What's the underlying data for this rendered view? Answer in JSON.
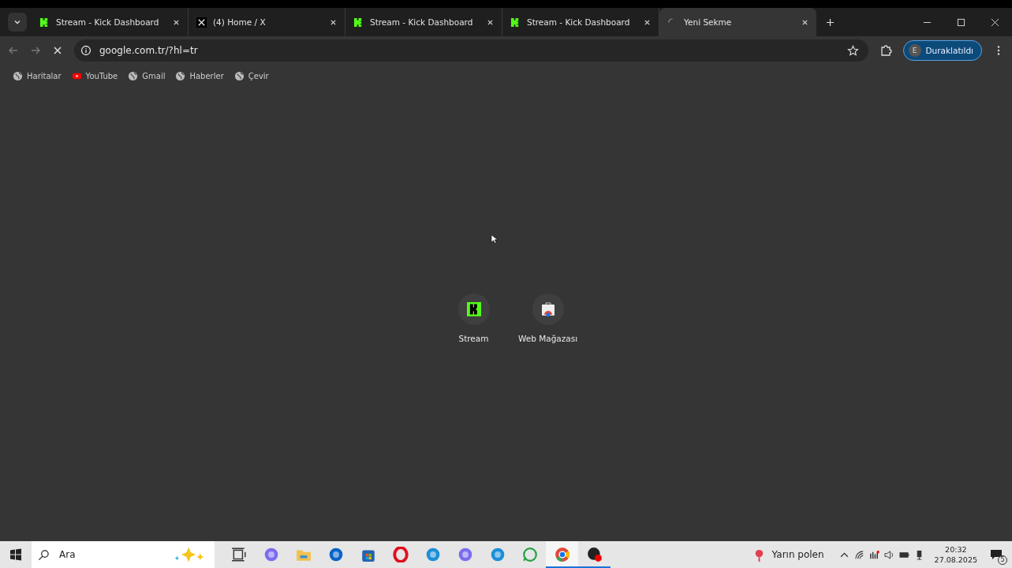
{
  "tabs": [
    {
      "kind": "kick",
      "title": "Stream - Kick Dashboard",
      "selected": false
    },
    {
      "kind": "x",
      "title": "(4) Home / X",
      "selected": false
    },
    {
      "kind": "kick",
      "title": "Stream - Kick Dashboard",
      "selected": false
    },
    {
      "kind": "kick",
      "title": "Stream - Kick Dashboard",
      "selected": false
    },
    {
      "kind": "loading",
      "title": "Yeni Sekme",
      "selected": true
    }
  ],
  "address_bar": {
    "url": "google.com.tr/?hl=tr",
    "loading": true
  },
  "profile": {
    "initial": "E",
    "label": "Duraklatıldı"
  },
  "bookmarks": [
    {
      "kind": "globe",
      "label": "Haritalar"
    },
    {
      "kind": "youtube",
      "label": "YouTube"
    },
    {
      "kind": "globe",
      "label": "Gmail"
    },
    {
      "kind": "globe",
      "label": "Haberler"
    },
    {
      "kind": "globe",
      "label": "Çevir"
    }
  ],
  "shortcuts": [
    {
      "kind": "kick",
      "label": "Stream"
    },
    {
      "kind": "webstore",
      "label": "Web Mağazası"
    }
  ],
  "taskbar": {
    "search_placeholder": "Ara",
    "apps": [
      {
        "kind": "taskview",
        "running": false,
        "selected": false
      },
      {
        "kind": "copilot",
        "running": false,
        "selected": false
      },
      {
        "kind": "folder",
        "running": false,
        "selected": false
      },
      {
        "kind": "outlook",
        "running": false,
        "selected": false
      },
      {
        "kind": "store",
        "running": false,
        "selected": false
      },
      {
        "kind": "opera",
        "running": false,
        "selected": false
      },
      {
        "kind": "edge",
        "running": false,
        "selected": false
      },
      {
        "kind": "copilot",
        "running": false,
        "selected": false
      },
      {
        "kind": "edge",
        "running": false,
        "selected": false
      },
      {
        "kind": "whatsapp",
        "running": false,
        "selected": false
      },
      {
        "kind": "chrome",
        "running": true,
        "selected": true
      },
      {
        "kind": "obs",
        "running": true,
        "selected": false
      }
    ],
    "weather": "Yarın polen",
    "time": "20:32",
    "date": "27.08.2025",
    "notifications": "5"
  }
}
